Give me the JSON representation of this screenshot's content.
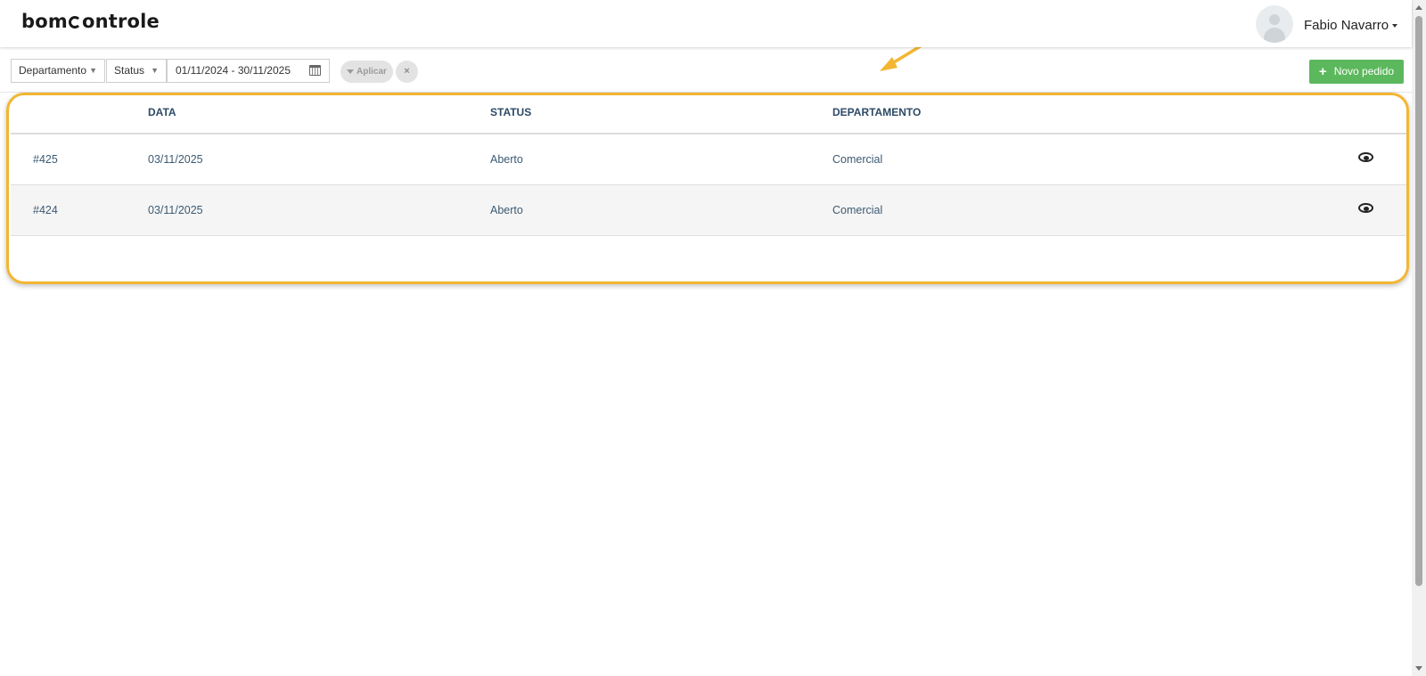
{
  "header": {
    "logo_part1": "bom",
    "logo_part2": "ontrole",
    "user_name": "Fabio Navarro"
  },
  "filters": {
    "department_label": "Departamento",
    "status_label": "Status",
    "date_range": "01/11/2024 - 30/11/2025",
    "apply_label": "Aplicar",
    "clear_label": "×",
    "new_order_label": "Novo pedido"
  },
  "table": {
    "columns": [
      "DATA",
      "STATUS",
      "DEPARTAMENTO"
    ],
    "rows": [
      {
        "id": "#425",
        "date": "03/11/2025",
        "status": "Aberto",
        "department": "Comercial"
      },
      {
        "id": "#424",
        "date": "03/11/2025",
        "status": "Aberto",
        "department": "Comercial"
      }
    ]
  },
  "colors": {
    "accent_green": "#5cb85c",
    "annotation_yellow": "#f2b632",
    "header_text": "#2c4a66"
  },
  "icons": [
    "calendar-icon",
    "filter-icon",
    "close-icon",
    "plus-icon",
    "eye-icon",
    "caret-down-icon"
  ]
}
